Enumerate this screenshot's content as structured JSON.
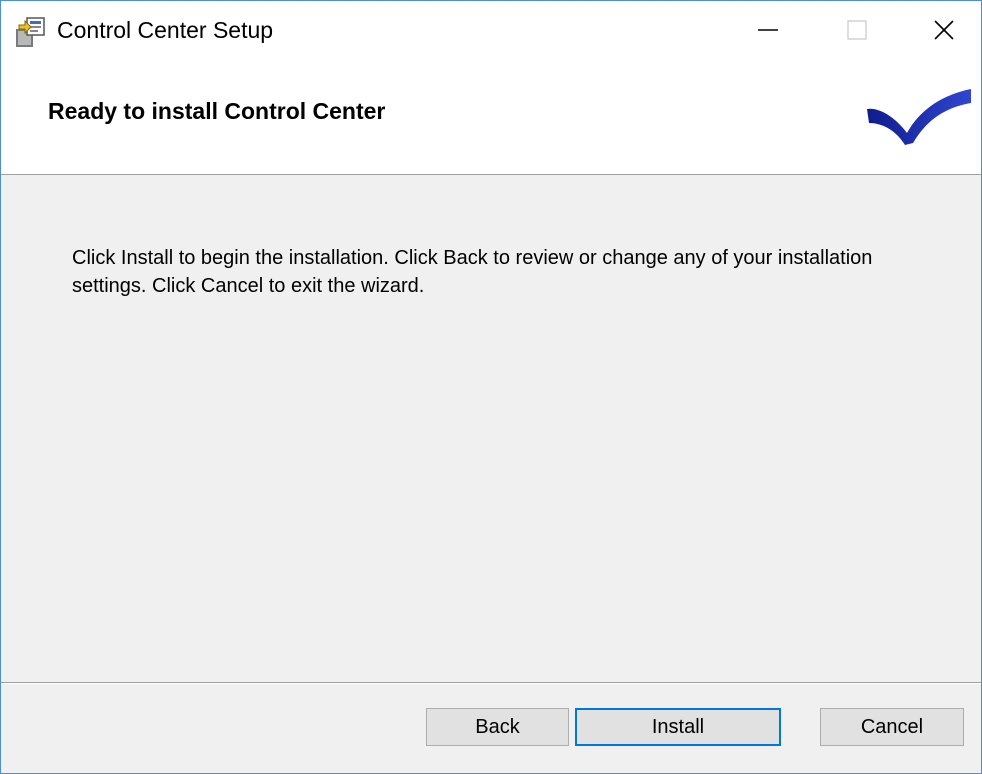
{
  "window": {
    "title": "Control Center Setup",
    "app_icon": "installer-package-icon",
    "controls": {
      "minimize_icon": "minimize-icon",
      "maximize_icon": "maximize-icon",
      "close_icon": "close-icon"
    }
  },
  "header": {
    "title": "Ready to install Control Center",
    "logo_icon": "checkmark-logo-icon"
  },
  "body": {
    "message": "Click Install to begin the installation. Click Back to review or change any of your installation settings. Click Cancel to exit the wizard."
  },
  "footer": {
    "back_label": "Back",
    "install_label": "Install",
    "cancel_label": "Cancel"
  },
  "colors": {
    "accent": "#0078d7",
    "window_border": "#4a8fd8",
    "logo_blue": "#1c2fa8",
    "dialog_background": "#f0f0f0"
  }
}
